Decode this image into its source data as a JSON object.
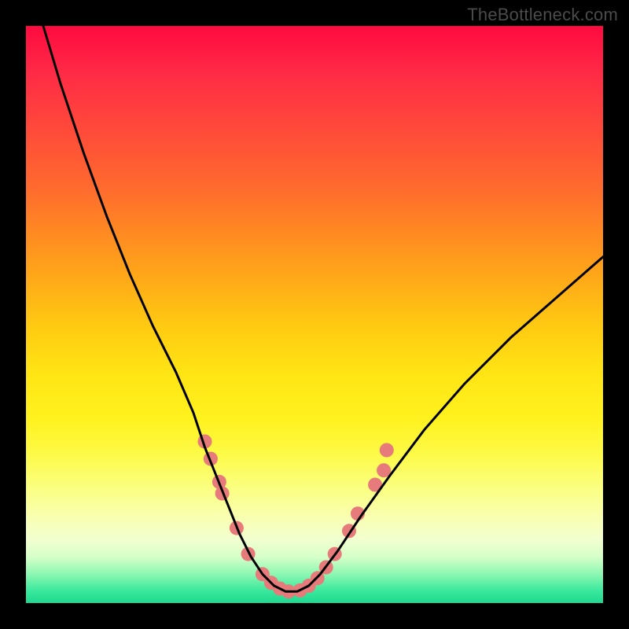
{
  "watermark": "TheBottleneck.com",
  "chart_data": {
    "type": "line",
    "title": "",
    "xlabel": "",
    "ylabel": "",
    "xlim": [
      0,
      100
    ],
    "ylim": [
      0,
      100
    ],
    "grid": false,
    "legend": false,
    "curve": {
      "name": "bottleneck-curve",
      "color": "#000000",
      "x": [
        3,
        6,
        10,
        14,
        18,
        22,
        26,
        29,
        31,
        33,
        35,
        37,
        39,
        41,
        43,
        45,
        47,
        49,
        51,
        54,
        58,
        63,
        69,
        76,
        84,
        92,
        100
      ],
      "y": [
        100,
        90,
        78,
        67,
        57,
        48,
        40,
        33,
        27,
        22,
        17,
        12,
        8,
        5,
        3,
        2,
        2,
        3,
        5,
        9,
        15,
        22,
        30,
        38,
        46,
        53,
        60
      ]
    },
    "markers": {
      "name": "highlight-points",
      "color": "#e77a7a",
      "radius": 9,
      "points": [
        {
          "x": 31.0,
          "y": 28.0
        },
        {
          "x": 32.0,
          "y": 25.0
        },
        {
          "x": 33.5,
          "y": 21.0
        },
        {
          "x": 34.0,
          "y": 19.0
        },
        {
          "x": 36.5,
          "y": 13.0
        },
        {
          "x": 38.5,
          "y": 8.5
        },
        {
          "x": 41.0,
          "y": 5.0
        },
        {
          "x": 42.5,
          "y": 3.5
        },
        {
          "x": 44.0,
          "y": 2.5
        },
        {
          "x": 45.5,
          "y": 2.0
        },
        {
          "x": 47.5,
          "y": 2.2
        },
        {
          "x": 49.0,
          "y": 3.0
        },
        {
          "x": 50.5,
          "y": 4.3
        },
        {
          "x": 52.0,
          "y": 6.2
        },
        {
          "x": 53.5,
          "y": 8.5
        },
        {
          "x": 56.0,
          "y": 12.5
        },
        {
          "x": 57.5,
          "y": 15.5
        },
        {
          "x": 60.5,
          "y": 20.5
        },
        {
          "x": 62.0,
          "y": 23.0
        },
        {
          "x": 62.5,
          "y": 26.5
        }
      ]
    }
  }
}
